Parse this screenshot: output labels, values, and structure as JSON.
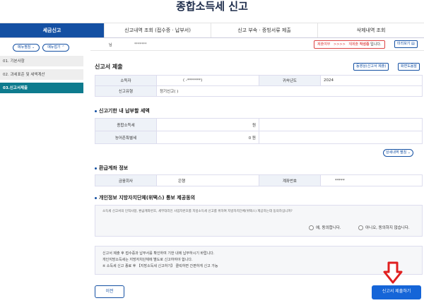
{
  "page_title": "종합소득세 신고",
  "tabs": [
    {
      "label": "세금신고",
      "active": true
    },
    {
      "label": "신고내역 조회 (접수증 · 납부서)"
    },
    {
      "label": "신고 부속 · 증빙서류 제출"
    },
    {
      "label": "삭제내역 조회"
    }
  ],
  "sidebar": {
    "menu_open": "메뉴펼침",
    "menu_close": "메뉴접기",
    "items": [
      "01. 기본사항",
      "02. 과세표준 및 세액계산",
      "03.신고서제출"
    ]
  },
  "header": {
    "user_suffix": "님",
    "masked": "*******",
    "status_label": "제출여부",
    "status_arrow": ">>>>",
    "status_prefix": "재제출",
    "status_highlight": "작성중",
    "status_suffix": "입니다.",
    "preview": "미리보기"
  },
  "submission": {
    "title": "신고서 제출",
    "btn_help": "동영상(신고서 제출)",
    "btn_guide": "화면도움말",
    "taxpayer_label": "소득자",
    "taxpayer_value": "( -*******)",
    "year_label": "귀속년도",
    "year_value": "2024",
    "type_label": "신고유형",
    "type_value": "정기신고(                    )"
  },
  "tax": {
    "title": "신고기한 내 납부할 세액",
    "rows": [
      {
        "label": "종합소득세",
        "value": "원"
      },
      {
        "label": "농어촌특별세",
        "value": "0 원"
      }
    ],
    "detail_btn": "상세내역 펼침"
  },
  "refund": {
    "title": "환급계좌 정보",
    "bank_label": "금융회사",
    "bank_value": "은행",
    "account_label": "계좌번호",
    "account_value": "*****"
  },
  "privacy": {
    "title": "개인정보 지방자치단체(위택스) 통보 제공동의",
    "text": "소득세 신고서의 인적사항, 환급계좌번호, 세무대리인 사업자번호를 지방소득세 신고를 위하여 지방자치단체(위택스) 제공하는데 동의하십니까?",
    "agree": "예, 동의합니다.",
    "disagree": "아니오, 동의하지 않습니다."
  },
  "notice": {
    "lines": [
      "신고서 제출 후 접수증과 납부서를 확인하여 기한 내에 납부하시기 바랍니다.",
      "개인지방소득세는 지방자치단체에 별도로 신고하여야 합니다.",
      "※ 소득세 신고 종료 후 【지방소득세 신고하기】 클릭하면 간편하게 신고 가능"
    ]
  },
  "footer": {
    "prev": "이전",
    "submit": "신고서 제출하기"
  },
  "colors": {
    "primary": "#1450a3",
    "accent": "#0e7b8e",
    "submit": "#1565d8",
    "arrow": "#e02020"
  }
}
